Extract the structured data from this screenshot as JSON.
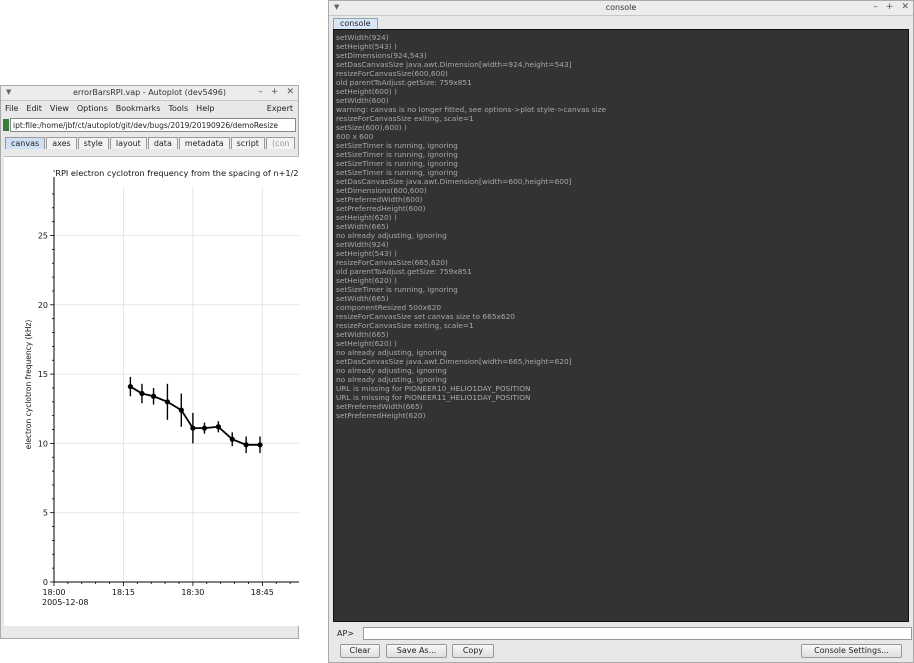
{
  "autoplot": {
    "title": "errorBarsRPI.vap - Autoplot (dev5496)",
    "menus": [
      "File",
      "Edit",
      "View",
      "Options",
      "Bookmarks",
      "Tools",
      "Help"
    ],
    "expert_label": "Expert",
    "uri": "ipt:file:/home/jbf/ct/autoplot/git/dev/bugs/2019/20190926/demoResize",
    "tabs": [
      "canvas",
      "axes",
      "style",
      "layout",
      "data",
      "metadata",
      "script",
      "(con"
    ],
    "selected_tab": "canvas"
  },
  "chart_data": {
    "type": "scatter",
    "title": "'RPI  electron cyclotron frequency from the spacing of n+1/2",
    "ylabel": "electron cyclotron frequency (kHz)",
    "xlabel": "",
    "x_tick_labels": [
      "18:00",
      "18:15",
      "18:30",
      "18:45"
    ],
    "x_tick_minutes": [
      0,
      15,
      30,
      45
    ],
    "x_date_label": "2005-12-08",
    "xlim_minutes": [
      0,
      54
    ],
    "y_ticks": [
      0,
      5,
      10,
      15,
      20,
      25
    ],
    "ylim": [
      0,
      28.5
    ],
    "grid": true,
    "series": [
      {
        "x_minutes": [
          16.5,
          19,
          21.5,
          24.5,
          27.5,
          30,
          32.5,
          35.5,
          38.5,
          41.5,
          44.5
        ],
        "y": [
          14.1,
          13.6,
          13.4,
          13.0,
          12.4,
          11.1,
          11.1,
          11.2,
          10.3,
          9.9,
          9.9
        ],
        "err": [
          0.7,
          0.7,
          0.6,
          1.3,
          1.2,
          1.1,
          0.4,
          0.4,
          0.5,
          0.6,
          0.6
        ]
      }
    ],
    "colors": {
      "line": "#000000",
      "grid": "#e6e6e6"
    }
  },
  "console": {
    "title": "console",
    "tab": "console",
    "lines": [
      "setWidth(924)",
      "setHeight(543) )",
      "setDimensions(924,543)",
      "setDasCanvasSize java.awt.Dimension[width=924,height=543]",
      "resizeForCanvasSize(600,600)",
      "old parentToAdjust.getSize: 759x851",
      "setHeight(600) )",
      "setWidth(600)",
      "warning: canvas is no longer fitted, see options->plot style->canvas size",
      "resizeForCanvasSize exiting, scale=1",
      "setSize(600),600) )",
      "600 x 600",
      "setSizeTimer is running, ignoring",
      "setSizeTimer is running, ignoring",
      "setSizeTimer is running, ignoring",
      "setSizeTimer is running, ignoring",
      "setDasCanvasSize java.awt.Dimension[width=600,height=600]",
      "setDimensions(600,600)",
      "setPreferredWidth(600)",
      "setPreferredHeight(600)",
      "setHeight(620) )",
      "setWidth(665)",
      "no already adjusting, ignoring",
      "setWidth(924)",
      "setHeight(543) )",
      "resizeForCanvasSize(665,620)",
      "old parentToAdjust.getSize: 759x851",
      "setHeight(620) )",
      "setSizeTimer is running, ignoring",
      "setWidth(665)",
      "componentResized 500x620",
      "resizeForCanvasSize set canvas size to  665x620",
      "resizeForCanvasSize exiting, scale=1",
      "setWidth(665)",
      "setHeight(620) )",
      "no already adjusting, ignoring",
      "setDasCanvasSize java.awt.Dimension[width=665,height=620]",
      "no already adjusting, ignoring",
      "no already adjusting, ignoring",
      "URL is missing for PIONEER10_HELIO1DAY_POSITION",
      "URL is missing for PIONEER11_HELIO1DAY_POSITION",
      "setPreferredWidth(665)",
      "setPreferredHeight(620)"
    ],
    "prompt_label": "AP>",
    "prompt_value": "",
    "buttons": {
      "clear": "Clear",
      "save_as": "Save As...",
      "copy": "Copy",
      "settings": "Console Settings..."
    }
  }
}
